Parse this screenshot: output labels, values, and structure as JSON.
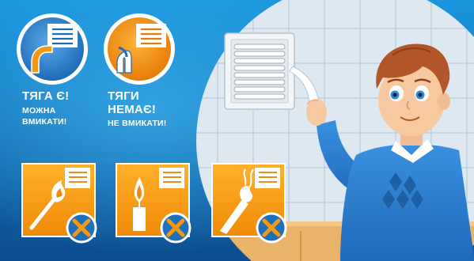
{
  "draft_ok": {
    "headline": "ТЯГА Є!",
    "line1": "МОЖНА",
    "line2": "ВМИКАТИ!",
    "icon": "vent-draft-ok-icon",
    "color": "#2e7ec9"
  },
  "draft_none": {
    "headline_line1": "ТЯГИ",
    "headline_line2": "НЕМАЄ!",
    "instruction": "НЕ ВМИКАТИ!",
    "icon": "vent-no-draft-icon",
    "color": "#f08c10"
  },
  "prohibited": [
    {
      "icon": "match-flame-prohibited-icon"
    },
    {
      "icon": "candle-prohibited-icon"
    },
    {
      "icon": "paper-torch-prohibited-icon"
    }
  ],
  "colors": {
    "background_top": "#1a96de",
    "background_bottom": "#0c4c8f",
    "accent_orange": "#f59a0c",
    "prohibit_blue": "#1f6fbf",
    "shirt_blue": "#2a7fd2"
  }
}
